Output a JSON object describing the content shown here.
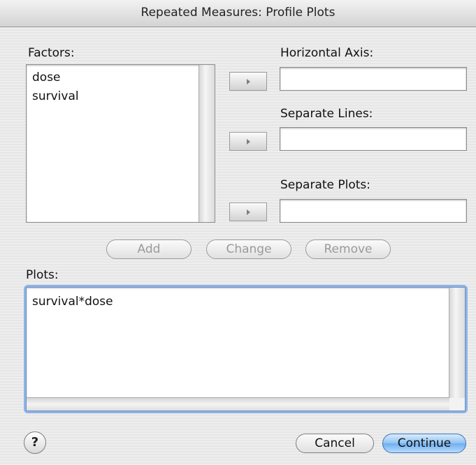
{
  "window": {
    "title": "Repeated Measures: Profile Plots"
  },
  "factors": {
    "label": "Factors:",
    "items": [
      "dose",
      "survival"
    ]
  },
  "horizontal_axis": {
    "label": "Horizontal Axis:",
    "value": ""
  },
  "separate_lines": {
    "label": "Separate Lines:",
    "value": ""
  },
  "separate_plots": {
    "label": "Separate Plots:",
    "value": ""
  },
  "buttons": {
    "add": "Add",
    "change": "Change",
    "remove": "Remove",
    "help": "?",
    "cancel": "Cancel",
    "continue": "Continue"
  },
  "plots": {
    "label": "Plots:",
    "items": [
      "survival*dose"
    ]
  },
  "icons": {
    "move_arrow": "right-triangle-icon",
    "help": "question-mark-icon"
  },
  "colors": {
    "default_button": "#6eaff0",
    "focus_ring": "#8db4e6"
  }
}
